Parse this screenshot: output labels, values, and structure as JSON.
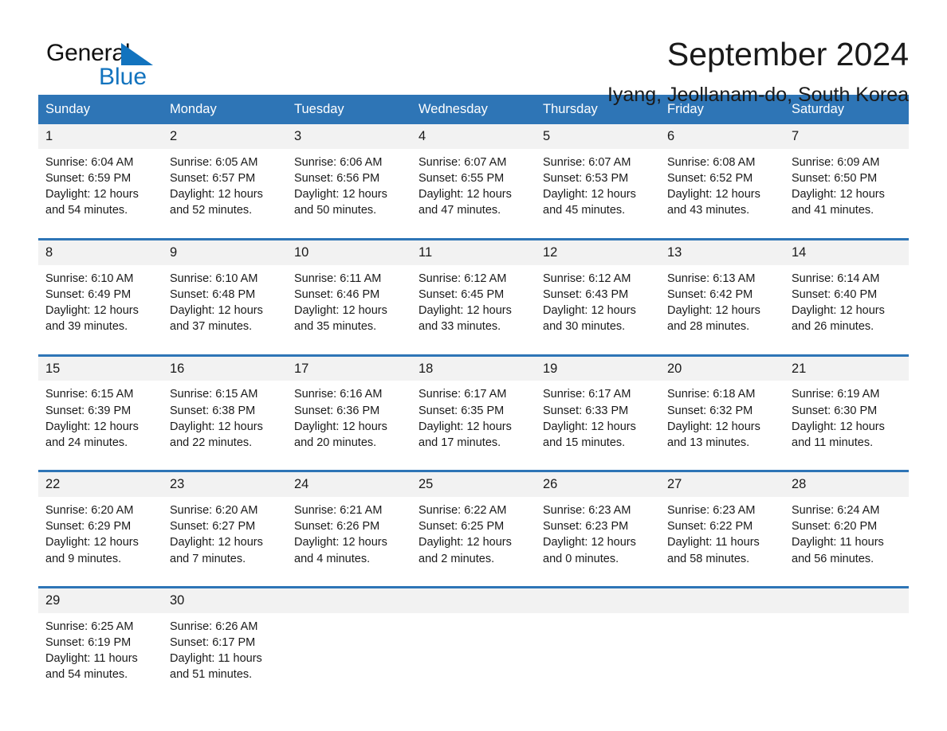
{
  "brand": {
    "name_part1": "General",
    "name_part2": "Blue",
    "accent_color": "#1273BE",
    "triangle_icon": "brand-triangle-icon"
  },
  "header": {
    "title": "September 2024",
    "subtitle": "Iyang, Jeollanam-do, South Korea"
  },
  "calendar": {
    "header_color": "#2E75B6",
    "date_band_color": "#F2F2F2",
    "weekdays": [
      "Sunday",
      "Monday",
      "Tuesday",
      "Wednesday",
      "Thursday",
      "Friday",
      "Saturday"
    ],
    "weeks": [
      [
        {
          "day": "1",
          "sunrise": "Sunrise: 6:04 AM",
          "sunset": "Sunset: 6:59 PM",
          "daylight": "Daylight: 12 hours and 54 minutes."
        },
        {
          "day": "2",
          "sunrise": "Sunrise: 6:05 AM",
          "sunset": "Sunset: 6:57 PM",
          "daylight": "Daylight: 12 hours and 52 minutes."
        },
        {
          "day": "3",
          "sunrise": "Sunrise: 6:06 AM",
          "sunset": "Sunset: 6:56 PM",
          "daylight": "Daylight: 12 hours and 50 minutes."
        },
        {
          "day": "4",
          "sunrise": "Sunrise: 6:07 AM",
          "sunset": "Sunset: 6:55 PM",
          "daylight": "Daylight: 12 hours and 47 minutes."
        },
        {
          "day": "5",
          "sunrise": "Sunrise: 6:07 AM",
          "sunset": "Sunset: 6:53 PM",
          "daylight": "Daylight: 12 hours and 45 minutes."
        },
        {
          "day": "6",
          "sunrise": "Sunrise: 6:08 AM",
          "sunset": "Sunset: 6:52 PM",
          "daylight": "Daylight: 12 hours and 43 minutes."
        },
        {
          "day": "7",
          "sunrise": "Sunrise: 6:09 AM",
          "sunset": "Sunset: 6:50 PM",
          "daylight": "Daylight: 12 hours and 41 minutes."
        }
      ],
      [
        {
          "day": "8",
          "sunrise": "Sunrise: 6:10 AM",
          "sunset": "Sunset: 6:49 PM",
          "daylight": "Daylight: 12 hours and 39 minutes."
        },
        {
          "day": "9",
          "sunrise": "Sunrise: 6:10 AM",
          "sunset": "Sunset: 6:48 PM",
          "daylight": "Daylight: 12 hours and 37 minutes."
        },
        {
          "day": "10",
          "sunrise": "Sunrise: 6:11 AM",
          "sunset": "Sunset: 6:46 PM",
          "daylight": "Daylight: 12 hours and 35 minutes."
        },
        {
          "day": "11",
          "sunrise": "Sunrise: 6:12 AM",
          "sunset": "Sunset: 6:45 PM",
          "daylight": "Daylight: 12 hours and 33 minutes."
        },
        {
          "day": "12",
          "sunrise": "Sunrise: 6:12 AM",
          "sunset": "Sunset: 6:43 PM",
          "daylight": "Daylight: 12 hours and 30 minutes."
        },
        {
          "day": "13",
          "sunrise": "Sunrise: 6:13 AM",
          "sunset": "Sunset: 6:42 PM",
          "daylight": "Daylight: 12 hours and 28 minutes."
        },
        {
          "day": "14",
          "sunrise": "Sunrise: 6:14 AM",
          "sunset": "Sunset: 6:40 PM",
          "daylight": "Daylight: 12 hours and 26 minutes."
        }
      ],
      [
        {
          "day": "15",
          "sunrise": "Sunrise: 6:15 AM",
          "sunset": "Sunset: 6:39 PM",
          "daylight": "Daylight: 12 hours and 24 minutes."
        },
        {
          "day": "16",
          "sunrise": "Sunrise: 6:15 AM",
          "sunset": "Sunset: 6:38 PM",
          "daylight": "Daylight: 12 hours and 22 minutes."
        },
        {
          "day": "17",
          "sunrise": "Sunrise: 6:16 AM",
          "sunset": "Sunset: 6:36 PM",
          "daylight": "Daylight: 12 hours and 20 minutes."
        },
        {
          "day": "18",
          "sunrise": "Sunrise: 6:17 AM",
          "sunset": "Sunset: 6:35 PM",
          "daylight": "Daylight: 12 hours and 17 minutes."
        },
        {
          "day": "19",
          "sunrise": "Sunrise: 6:17 AM",
          "sunset": "Sunset: 6:33 PM",
          "daylight": "Daylight: 12 hours and 15 minutes."
        },
        {
          "day": "20",
          "sunrise": "Sunrise: 6:18 AM",
          "sunset": "Sunset: 6:32 PM",
          "daylight": "Daylight: 12 hours and 13 minutes."
        },
        {
          "day": "21",
          "sunrise": "Sunrise: 6:19 AM",
          "sunset": "Sunset: 6:30 PM",
          "daylight": "Daylight: 12 hours and 11 minutes."
        }
      ],
      [
        {
          "day": "22",
          "sunrise": "Sunrise: 6:20 AM",
          "sunset": "Sunset: 6:29 PM",
          "daylight": "Daylight: 12 hours and 9 minutes."
        },
        {
          "day": "23",
          "sunrise": "Sunrise: 6:20 AM",
          "sunset": "Sunset: 6:27 PM",
          "daylight": "Daylight: 12 hours and 7 minutes."
        },
        {
          "day": "24",
          "sunrise": "Sunrise: 6:21 AM",
          "sunset": "Sunset: 6:26 PM",
          "daylight": "Daylight: 12 hours and 4 minutes."
        },
        {
          "day": "25",
          "sunrise": "Sunrise: 6:22 AM",
          "sunset": "Sunset: 6:25 PM",
          "daylight": "Daylight: 12 hours and 2 minutes."
        },
        {
          "day": "26",
          "sunrise": "Sunrise: 6:23 AM",
          "sunset": "Sunset: 6:23 PM",
          "daylight": "Daylight: 12 hours and 0 minutes."
        },
        {
          "day": "27",
          "sunrise": "Sunrise: 6:23 AM",
          "sunset": "Sunset: 6:22 PM",
          "daylight": "Daylight: 11 hours and 58 minutes."
        },
        {
          "day": "28",
          "sunrise": "Sunrise: 6:24 AM",
          "sunset": "Sunset: 6:20 PM",
          "daylight": "Daylight: 11 hours and 56 minutes."
        }
      ],
      [
        {
          "day": "29",
          "sunrise": "Sunrise: 6:25 AM",
          "sunset": "Sunset: 6:19 PM",
          "daylight": "Daylight: 11 hours and 54 minutes."
        },
        {
          "day": "30",
          "sunrise": "Sunrise: 6:26 AM",
          "sunset": "Sunset: 6:17 PM",
          "daylight": "Daylight: 11 hours and 51 minutes."
        },
        {
          "day": "",
          "sunrise": "",
          "sunset": "",
          "daylight": ""
        },
        {
          "day": "",
          "sunrise": "",
          "sunset": "",
          "daylight": ""
        },
        {
          "day": "",
          "sunrise": "",
          "sunset": "",
          "daylight": ""
        },
        {
          "day": "",
          "sunrise": "",
          "sunset": "",
          "daylight": ""
        },
        {
          "day": "",
          "sunrise": "",
          "sunset": "",
          "daylight": ""
        }
      ]
    ]
  }
}
